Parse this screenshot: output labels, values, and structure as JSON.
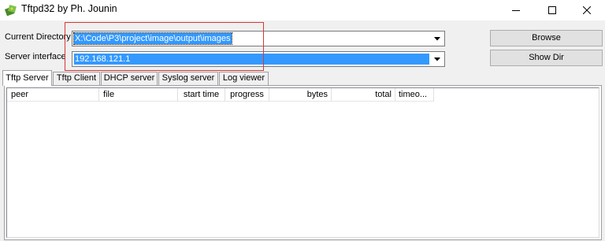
{
  "window": {
    "title": "Tftpd32 by Ph. Jounin",
    "icon": "tftpd32-app-icon",
    "controls": [
      "minimize-icon",
      "maximize-icon",
      "close-icon"
    ]
  },
  "form": {
    "current_directory_label": "Current Directory",
    "current_directory_value": "X:\\Code\\P3\\project\\image\\output\\images",
    "server_interface_label": "Server interface",
    "server_interface_value": "192.168.121.1",
    "browse_label": "Browse",
    "show_dir_label": "Show Dir"
  },
  "tabs": [
    {
      "label": "Tftp Server",
      "active": true
    },
    {
      "label": "Tftp Client",
      "active": false
    },
    {
      "label": "DHCP server",
      "active": false
    },
    {
      "label": "Syslog server",
      "active": false
    },
    {
      "label": "Log viewer",
      "active": false
    }
  ],
  "table": {
    "columns": [
      "peer",
      "file",
      "start time",
      "progress",
      "bytes",
      "total",
      "timeo..."
    ],
    "rows": []
  },
  "colors": {
    "selection": "#3399ff",
    "highlight_box": "#d93636",
    "window_bg": "#f0f0f0"
  }
}
